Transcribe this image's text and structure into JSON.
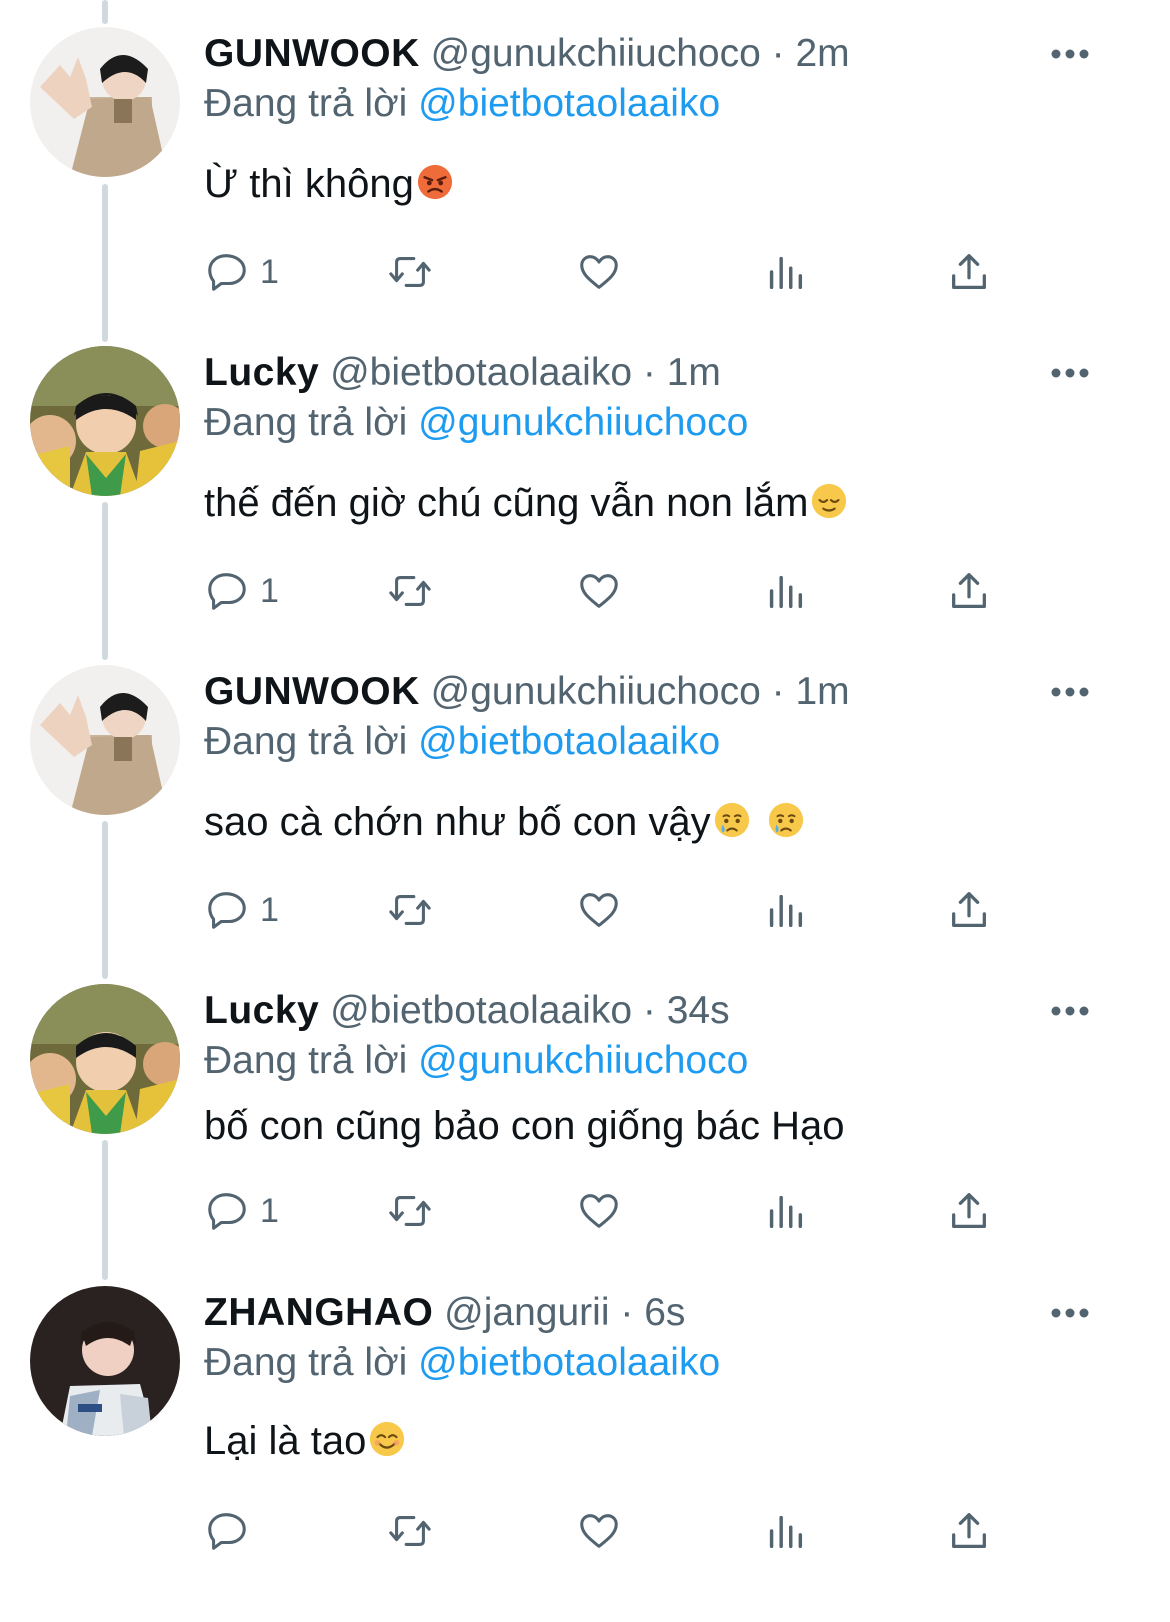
{
  "tweets": [
    {
      "name": "GUNWOOK",
      "handle": "@gunukchiiuchoco",
      "time": "2m",
      "replying_prefix": "Đang trả lời",
      "replying_to": "@bietbotaolaaiko",
      "text": "Ừ thì không",
      "emoji": [
        "angry-face"
      ],
      "reply_count": "1",
      "avatar": "gunwook"
    },
    {
      "name": "Lucky",
      "handle": "@bietbotaolaaiko",
      "time": "1m",
      "replying_prefix": "Đang trả lời",
      "replying_to": "@gunukchiiuchoco",
      "text": "thế đến giờ chú cũng vẫn non lắm",
      "emoji": [
        "relieved-face"
      ],
      "reply_count": "1",
      "avatar": "lucky"
    },
    {
      "name": "GUNWOOK",
      "handle": "@gunukchiiuchoco",
      "time": "1m",
      "replying_prefix": "Đang trả lời",
      "replying_to": "@bietbotaolaaiko",
      "text": "sao cà chớn như bố con vậy",
      "emoji": [
        "crying-face",
        "crying-face"
      ],
      "reply_count": "1",
      "avatar": "gunwook"
    },
    {
      "name": "Lucky",
      "handle": "@bietbotaolaaiko",
      "time": "34s",
      "replying_prefix": "Đang trả lời",
      "replying_to": "@gunukchiiuchoco",
      "text": "bố con cũng bảo con giống bác Hạo",
      "emoji": [],
      "reply_count": "1",
      "avatar": "lucky"
    },
    {
      "name": "ZHANGHAO",
      "handle": "@jangurii",
      "time": "6s",
      "replying_prefix": "Đang trả lời",
      "replying_to": "@bietbotaolaaiko",
      "text": "Lại là tao",
      "emoji": [
        "smiling-face"
      ],
      "reply_count": "",
      "avatar": "zhanghao"
    }
  ],
  "separator": "·",
  "colors": {
    "accent": "#1d9bf0",
    "secondary_text": "#536471",
    "thread_line": "#cfd9de"
  }
}
